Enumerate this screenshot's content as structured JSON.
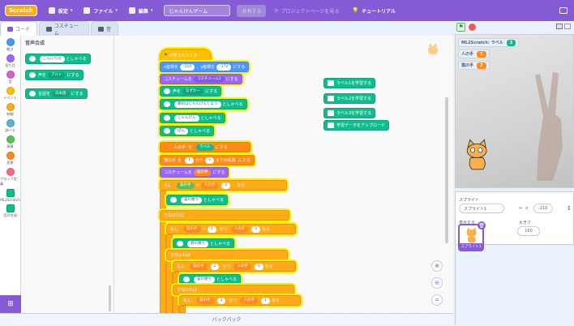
{
  "menubar": {
    "logo": "Scratch",
    "settings": "設定",
    "file": "ファイル",
    "edit": "編集",
    "project_title": "じゃんけんゲーム",
    "share": "共有する",
    "see_project_page": "プロジェクトページを見る",
    "tutorials": "チュートリアル"
  },
  "tabs": {
    "code": "コード",
    "costumes": "コスチューム",
    "sounds": "音"
  },
  "categories": [
    "動き",
    "見た目",
    "音",
    "イベント",
    "制御",
    "調べる",
    "演算",
    "変数",
    "ブロック定義",
    "ML2Scratch",
    "音声合成"
  ],
  "palette": {
    "heading": "音声合成",
    "block1": {
      "text": "こんにちは",
      "suffix": "としゃべる"
    },
    "block2": {
      "prefix": "声を",
      "voice": "アルト",
      "suffix": "にする"
    },
    "block3": {
      "prefix": "言語を",
      "lang": "日本語",
      "suffix": "にする"
    }
  },
  "script": {
    "hat": "が押されたとき",
    "goto": {
      "a": "x座標を",
      "x": "-210",
      "b": "、y座標を",
      "y": "-172",
      "c": "にする"
    },
    "costume": {
      "a": "コスチュームを",
      "v": "コスチューム1",
      "b": "にする"
    },
    "voice": {
      "a": "声を",
      "v": "なずかー",
      "b": "にする"
    },
    "say1": {
      "v": "最初はじゃんけんしよう",
      "b": "としゃべる"
    },
    "say2": {
      "v": "じゃんけん",
      "b": "としゃべる"
    },
    "say3": {
      "v": "ぽん",
      "b": "としゃべる"
    },
    "set_player": {
      "a": "人の手",
      "b": "を",
      "v": "ラベル",
      "c": "にする"
    },
    "set_cpu": {
      "a": "猫の手",
      "b": "を",
      "v1": "1",
      "c": "から",
      "v2": "3",
      "d": "までの乱数",
      "e": "にする"
    },
    "costume2": {
      "a": "コスチュームを",
      "v": "猫の手",
      "b": "にする"
    },
    "if1": {
      "a": "もし",
      "l": "猫の手",
      "eq": "=",
      "r": "人の手",
      "n": "2",
      "t": "なら"
    },
    "say_cat": {
      "v": "猫の勝ち",
      "b": "としゃべる"
    },
    "else": "でなければ",
    "if2": {
      "a": "もし",
      "l": "猫の手",
      "eq": "=",
      "n1": "1",
      "and": "かつ",
      "r": "人の手",
      "n2": "3",
      "t": "なら"
    },
    "say_player": {
      "v": "君の勝ち",
      "b": "としゃべる"
    },
    "if3": {
      "a": "もし",
      "l": "猫の手",
      "n1": "2",
      "and": "かつ",
      "r": "人の手",
      "n2": "3",
      "t": "なら"
    },
    "say_cat2": {
      "v": "猫の勝ち",
      "b": "としゃべる"
    },
    "if4": {
      "a": "もし",
      "l": "猫の手",
      "n1": "2",
      "and": "かつ",
      "r": "人の手",
      "n2": "1",
      "t": "なら"
    }
  },
  "ml_blocks": [
    "ラベル1を学習する",
    "ラベル2を学習する",
    "ラベル3を学習する",
    "学習データをアップロード"
  ],
  "backpack": "バックパック",
  "stage": {
    "monitor_label": {
      "name": "ML2Scratch: ラベル",
      "value": "2",
      "color": "#0fbd8c"
    },
    "monitor_player": {
      "name": "人の手",
      "value": "1",
      "color": "#ff8c1a"
    },
    "monitor_cpu": {
      "name": "猫の手",
      "value": "2",
      "color": "#ff8c1a"
    }
  },
  "sprite_info": {
    "sprite_label": "スプライト",
    "sprite_name": "スプライト1",
    "x_label": "x",
    "x_value": "-210",
    "show_label": "表示する",
    "size_label": "大きさ",
    "size_value": "100",
    "thumb_name": "スプライト1"
  },
  "colors": {
    "menubar": "#855cd6",
    "motion": "#4c97ff",
    "looks": "#9966ff",
    "events": "#ffbf00",
    "control": "#ffab19",
    "variables": "#ff8c1a",
    "extension": "#0fbd8c"
  }
}
